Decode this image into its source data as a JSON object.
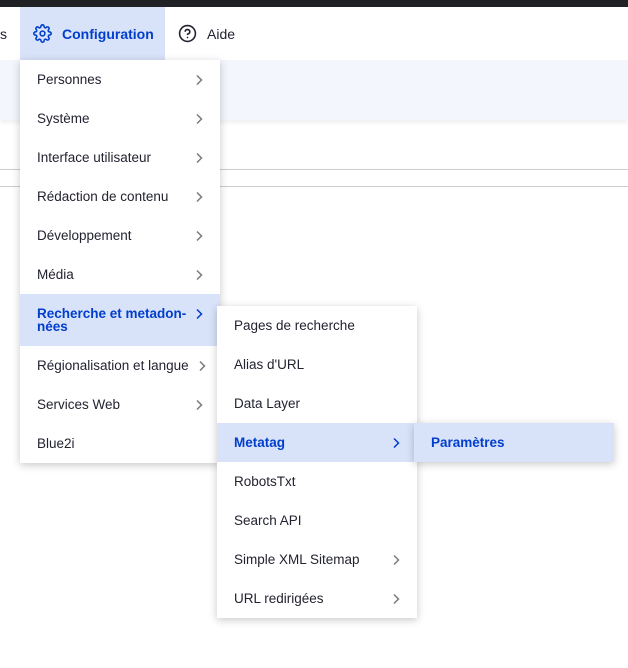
{
  "toolbar": {
    "partial_text": "s",
    "configuration_label": "Configuration",
    "aide_label": "Aide"
  },
  "menu_level1": {
    "items": [
      {
        "label": "Personnes"
      },
      {
        "label": "Système"
      },
      {
        "label": "Interface utilisateur"
      },
      {
        "label": "Rédaction de contenu"
      },
      {
        "label": "Développement"
      },
      {
        "label": "Média"
      },
      {
        "label_line1": "Recherche et metadon-",
        "label_line2": "nées",
        "active": true
      },
      {
        "label": "Régionalisation et langue"
      },
      {
        "label": "Services Web"
      },
      {
        "label": "Blue2i"
      }
    ]
  },
  "menu_level2": {
    "items": [
      {
        "label": "Pages de recherche"
      },
      {
        "label": "Alias d'URL"
      },
      {
        "label": "Data Layer"
      },
      {
        "label": "Metatag",
        "active": true
      },
      {
        "label": "RobotsTxt"
      },
      {
        "label": "Search API"
      },
      {
        "label": "Simple XML Sitemap"
      },
      {
        "label": "URL redirigées"
      }
    ]
  },
  "menu_level3": {
    "items": [
      {
        "label": "Paramètres",
        "active": true
      }
    ]
  },
  "colors": {
    "accent": "#003ecc",
    "active_bg": "#d8e2f9",
    "text": "#222330"
  },
  "icons": {
    "configuration": "gear-icon",
    "aide": "help-circle-icon",
    "submenu": "chevron-right-icon"
  }
}
